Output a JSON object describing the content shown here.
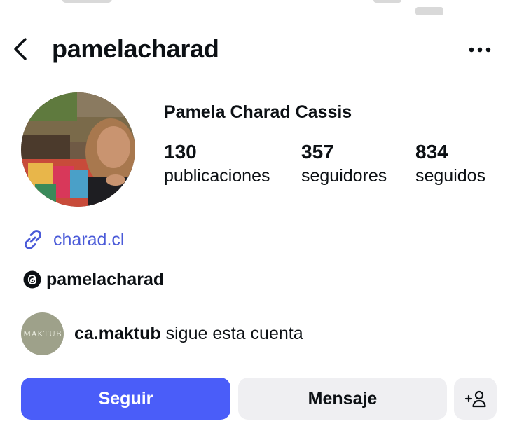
{
  "header": {
    "username": "pamelacharad",
    "back_icon": "chevron-left-icon",
    "more_icon": "more-horizontal-icon"
  },
  "profile": {
    "full_name": "Pamela Charad Cassis",
    "stats": [
      {
        "value": "130",
        "label": "publicaciones"
      },
      {
        "value": "357",
        "label": "seguidores"
      },
      {
        "value": "834",
        "label": "seguidos"
      }
    ],
    "link": {
      "icon": "link-icon",
      "text": "charad.cl"
    },
    "threads": {
      "icon": "threads-icon",
      "handle": "pamelacharad"
    }
  },
  "followed_by": {
    "avatar_text": "MAKTUB",
    "username": "ca.maktub",
    "text": "sigue esta cuenta"
  },
  "actions": {
    "follow_label": "Seguir",
    "message_label": "Mensaje",
    "suggest_label": "+"
  },
  "colors": {
    "accent": "#4a5df9",
    "link": "#4a5ad8",
    "secondary_button": "#efeff2",
    "text": "#0c1014"
  }
}
